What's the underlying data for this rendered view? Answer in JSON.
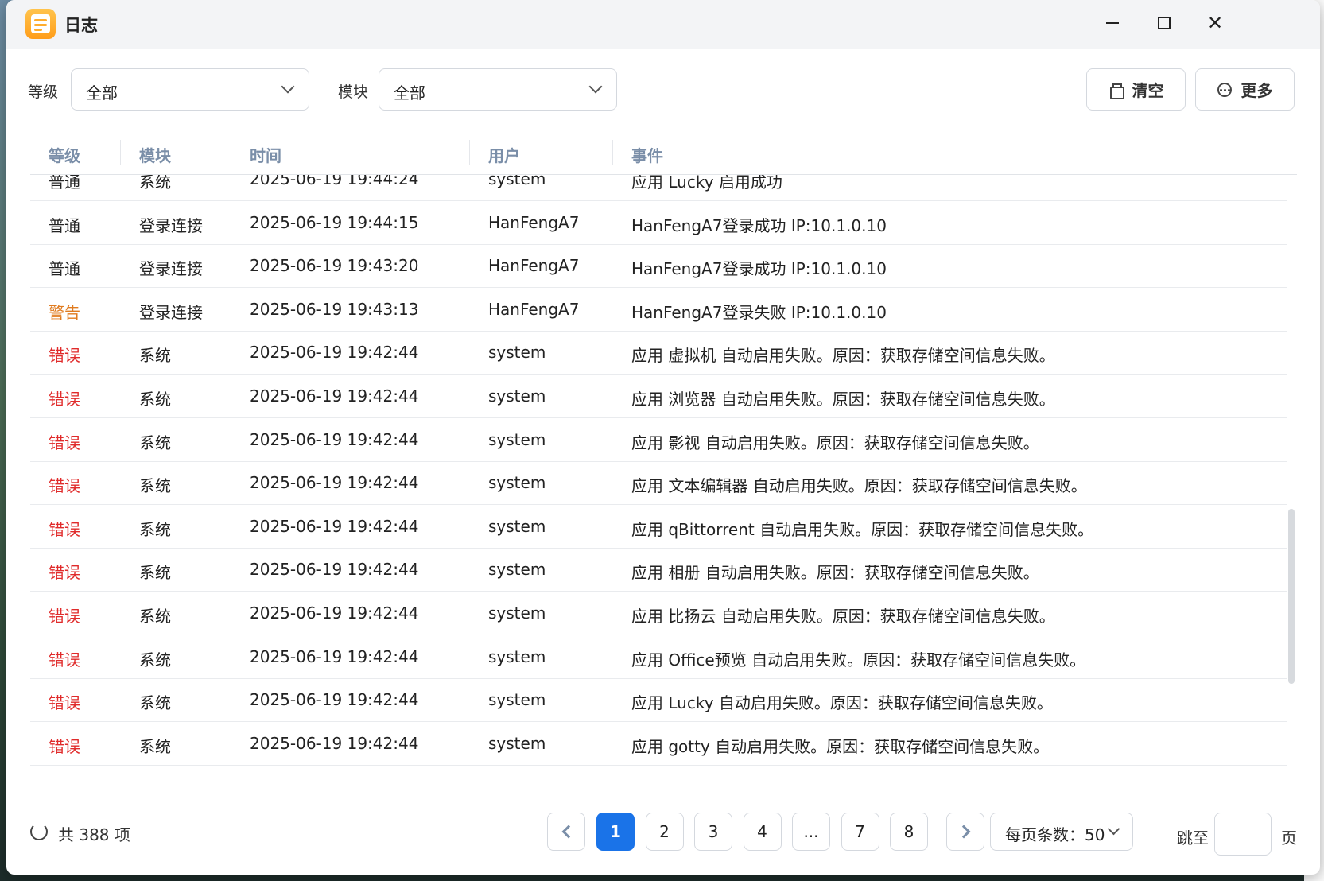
{
  "window": {
    "title": "日志"
  },
  "filters": {
    "level_label": "等级",
    "level_value": "全部",
    "module_label": "模块",
    "module_value": "全部"
  },
  "toolbar": {
    "clear_label": "清空",
    "more_label": "更多"
  },
  "table": {
    "columns": [
      "等级",
      "模块",
      "时间",
      "用户",
      "事件"
    ],
    "rows": [
      {
        "level": "普通",
        "level_type": "normal",
        "module": "系统",
        "time": "2025-06-19 19:44:24",
        "user": "system",
        "event": "应用 Lucky 启用成功"
      },
      {
        "level": "普通",
        "level_type": "normal",
        "module": "登录连接",
        "time": "2025-06-19 19:44:15",
        "user": "HanFengA7",
        "event": "HanFengA7登录成功 IP:10.1.0.10"
      },
      {
        "level": "普通",
        "level_type": "normal",
        "module": "登录连接",
        "time": "2025-06-19 19:43:20",
        "user": "HanFengA7",
        "event": "HanFengA7登录成功 IP:10.1.0.10"
      },
      {
        "level": "警告",
        "level_type": "warn",
        "module": "登录连接",
        "time": "2025-06-19 19:43:13",
        "user": "HanFengA7",
        "event": "HanFengA7登录失败 IP:10.1.0.10"
      },
      {
        "level": "错误",
        "level_type": "error",
        "module": "系统",
        "time": "2025-06-19 19:42:44",
        "user": "system",
        "event": "应用 虚拟机 自动启用失败。原因：获取存储空间信息失败。"
      },
      {
        "level": "错误",
        "level_type": "error",
        "module": "系统",
        "time": "2025-06-19 19:42:44",
        "user": "system",
        "event": "应用 浏览器 自动启用失败。原因：获取存储空间信息失败。"
      },
      {
        "level": "错误",
        "level_type": "error",
        "module": "系统",
        "time": "2025-06-19 19:42:44",
        "user": "system",
        "event": "应用 影视 自动启用失败。原因：获取存储空间信息失败。"
      },
      {
        "level": "错误",
        "level_type": "error",
        "module": "系统",
        "time": "2025-06-19 19:42:44",
        "user": "system",
        "event": "应用 文本编辑器 自动启用失败。原因：获取存储空间信息失败。"
      },
      {
        "level": "错误",
        "level_type": "error",
        "module": "系统",
        "time": "2025-06-19 19:42:44",
        "user": "system",
        "event": "应用 qBittorrent 自动启用失败。原因：获取存储空间信息失败。"
      },
      {
        "level": "错误",
        "level_type": "error",
        "module": "系统",
        "time": "2025-06-19 19:42:44",
        "user": "system",
        "event": "应用 相册 自动启用失败。原因：获取存储空间信息失败。"
      },
      {
        "level": "错误",
        "level_type": "error",
        "module": "系统",
        "time": "2025-06-19 19:42:44",
        "user": "system",
        "event": "应用 比扬云 自动启用失败。原因：获取存储空间信息失败。"
      },
      {
        "level": "错误",
        "level_type": "error",
        "module": "系统",
        "time": "2025-06-19 19:42:44",
        "user": "system",
        "event": "应用 Office预览 自动启用失败。原因：获取存储空间信息失败。"
      },
      {
        "level": "错误",
        "level_type": "error",
        "module": "系统",
        "time": "2025-06-19 19:42:44",
        "user": "system",
        "event": "应用 Lucky 自动启用失败。原因：获取存储空间信息失败。"
      },
      {
        "level": "错误",
        "level_type": "error",
        "module": "系统",
        "time": "2025-06-19 19:42:44",
        "user": "system",
        "event": "应用 gotty 自动启用失败。原因：获取存储空间信息失败。"
      }
    ]
  },
  "footer": {
    "total_text": "共 388 项",
    "pages": [
      "1",
      "2",
      "3",
      "4",
      "...",
      "7",
      "8"
    ],
    "current_page": "1",
    "per_page_text": "每页条数：50",
    "jump_label": "跳至",
    "jump_value": "",
    "page_suffix": "页"
  },
  "colors": {
    "accent": "#1a73e8",
    "error": "#e02b2b",
    "warn": "#e07b1f",
    "header_text": "#7a8ea8"
  },
  "icons": [
    "app-log-icon",
    "minimize-icon",
    "maximize-icon",
    "close-icon",
    "chevron-down-icon",
    "trash-icon",
    "more-icon",
    "refresh-icon",
    "chevron-left-icon",
    "chevron-right-icon"
  ]
}
